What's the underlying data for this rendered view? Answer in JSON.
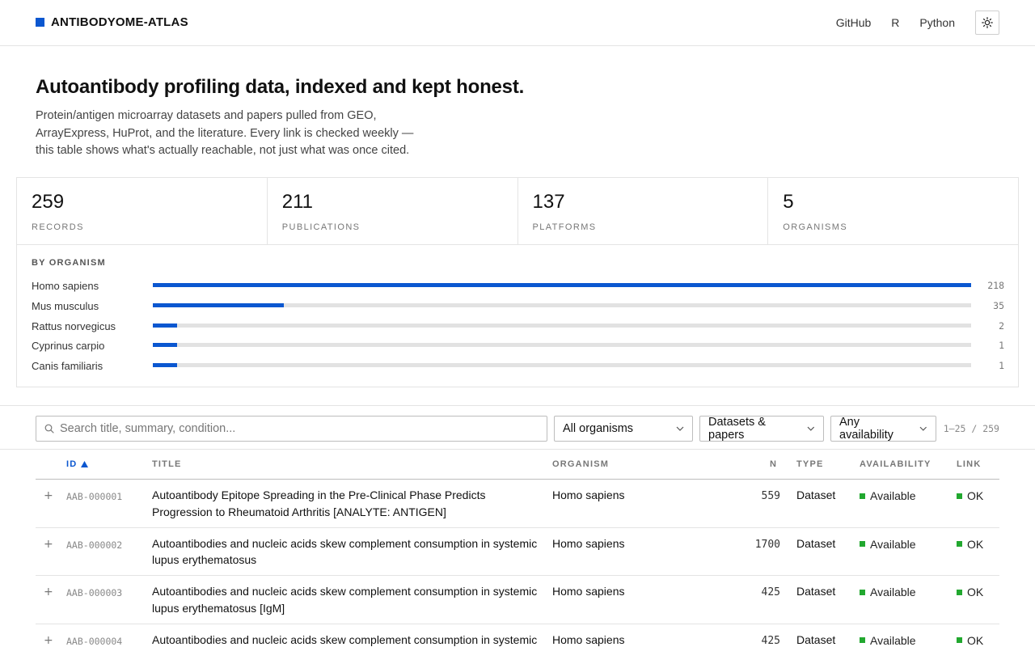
{
  "brand": {
    "name": "ANTIBODYOME-ATLAS",
    "accent": "#0b57d0"
  },
  "nav": {
    "links": [
      "GitHub",
      "R",
      "Python"
    ],
    "theme_icon": "sun-icon"
  },
  "hero": {
    "title": "Autoantibody profiling data, indexed and kept honest.",
    "subtitle": "Protein/antigen microarray datasets and papers pulled from GEO, ArrayExpress, HuProt, and the literature. Every link is checked weekly — this table shows what's actually reachable, not just what was once cited."
  },
  "stats": [
    {
      "value": "259",
      "label": "RECORDS"
    },
    {
      "value": "211",
      "label": "PUBLICATIONS"
    },
    {
      "value": "137",
      "label": "PLATFORMS"
    },
    {
      "value": "5",
      "label": "ORGANISMS"
    }
  ],
  "organisms": {
    "heading": "BY ORGANISM",
    "max": 218,
    "items": [
      {
        "name": "Homo sapiens",
        "count": 218
      },
      {
        "name": "Mus musculus",
        "count": 35
      },
      {
        "name": "Rattus norvegicus",
        "count": 2
      },
      {
        "name": "Cyprinus carpio",
        "count": 1
      },
      {
        "name": "Canis familiaris",
        "count": 1
      }
    ]
  },
  "filters": {
    "search_placeholder": "Search title, summary, condition...",
    "organism": "All organisms",
    "type": "Datasets & papers",
    "availability": "Any availability",
    "range": "1–25 / 259"
  },
  "table": {
    "headers": {
      "id": "ID",
      "title": "TITLE",
      "organism": "ORGANISM",
      "n": "N",
      "type": "TYPE",
      "availability": "AVAILABILITY",
      "link": "LINK"
    },
    "status_color": "#22a82f",
    "rows": [
      {
        "expand": "+",
        "id": "AAB-000001",
        "title": "Autoantibody Epitope Spreading in the Pre-Clinical Phase Predicts Progression to Rheumatoid Arthritis [ANALYTE: ANTIGEN]",
        "organism": "Homo sapiens",
        "n": "559",
        "type": "Dataset",
        "availability": "Available",
        "link": "OK"
      },
      {
        "expand": "+",
        "id": "AAB-000002",
        "title": "Autoantibodies and nucleic acids skew complement consumption in systemic lupus erythematosus",
        "organism": "Homo sapiens",
        "n": "1700",
        "type": "Dataset",
        "availability": "Available",
        "link": "OK"
      },
      {
        "expand": "+",
        "id": "AAB-000003",
        "title": "Autoantibodies and nucleic acids skew complement consumption in systemic lupus erythematosus [IgM]",
        "organism": "Homo sapiens",
        "n": "425",
        "type": "Dataset",
        "availability": "Available",
        "link": "OK"
      },
      {
        "expand": "+",
        "id": "AAB-000004",
        "title": "Autoantibodies and nucleic acids skew complement consumption in systemic",
        "organism": "Homo sapiens",
        "n": "425",
        "type": "Dataset",
        "availability": "Available",
        "link": "OK"
      }
    ]
  }
}
